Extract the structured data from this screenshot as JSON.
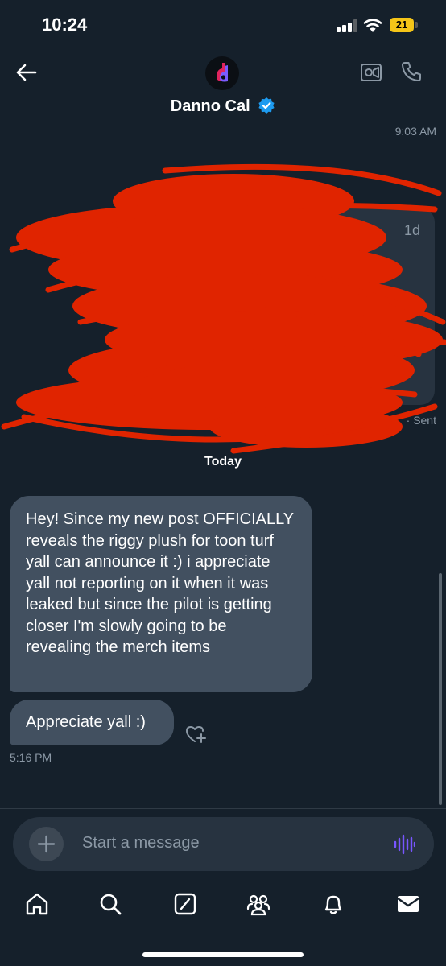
{
  "status_bar": {
    "time": "10:24",
    "battery": "21"
  },
  "header": {
    "contact_name": "Danno Cal",
    "verified": true
  },
  "conversation": {
    "first_timestamp": "9:03 AM",
    "redacted_message": {
      "age": "1d",
      "status_suffix": "Sent"
    },
    "date_separator": "Today",
    "messages": [
      {
        "from": "contact",
        "text": "Hey! Since my new post OFFICIALLY reveals the riggy plush for toon turf yall can announce it :) i appreciate yall not reporting on it when it was leaked but since the pilot is getting closer I'm slowly going to be revealing the merch items"
      },
      {
        "from": "contact",
        "text": "Appreciate yall :)"
      }
    ],
    "last_timestamp": "5:16 PM"
  },
  "composer": {
    "placeholder": "Start a message"
  },
  "tab_bar": {
    "items": [
      "home-icon",
      "search-icon",
      "grok-icon",
      "communities-icon",
      "notifications-icon",
      "messages-icon"
    ],
    "active": "messages-icon"
  },
  "colors": {
    "background": "#15202b",
    "bubble": "#425060",
    "accent": "#1d9bf0",
    "redaction": "#e02400",
    "voice": "#7856ff"
  }
}
